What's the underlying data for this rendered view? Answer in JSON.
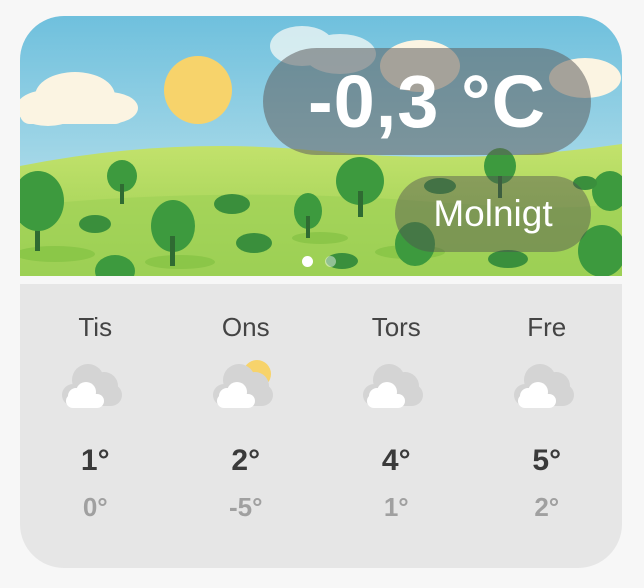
{
  "current": {
    "temperature": "-0,3 °C",
    "condition": "Molnigt",
    "page_indicator": {
      "count": 2,
      "active": 0
    }
  },
  "forecast": [
    {
      "day": "Tis",
      "high": "1°",
      "low": "0°",
      "icon": "cloudy-icon"
    },
    {
      "day": "Ons",
      "high": "2°",
      "low": "-5°",
      "icon": "partly-cloudy-icon"
    },
    {
      "day": "Tors",
      "high": "4°",
      "low": "1°",
      "icon": "cloudy-icon"
    },
    {
      "day": "Fre",
      "high": "5°",
      "low": "2°",
      "icon": "cloudy-icon"
    }
  ],
  "colors": {
    "sky_top": "#74c6e0",
    "grass": "#a8d85a",
    "sun": "#f7d36b",
    "panel": "#e6e6e6"
  }
}
